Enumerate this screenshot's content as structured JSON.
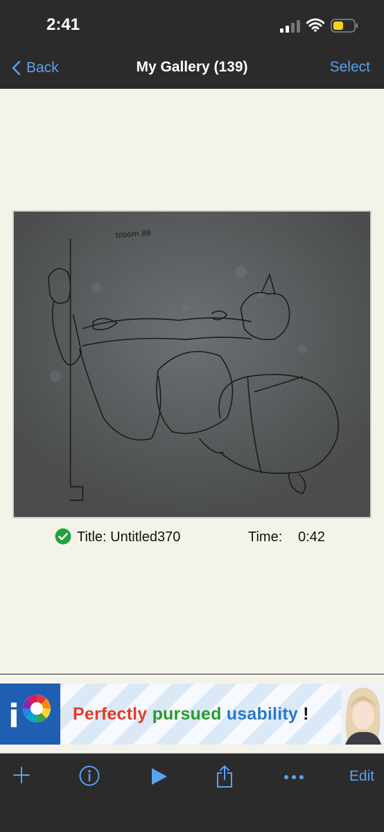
{
  "status": {
    "time": "2:41"
  },
  "nav": {
    "back_label": "Back",
    "title": "My Gallery (139)",
    "select_label": "Select"
  },
  "artwork": {
    "signature": "bloom 88"
  },
  "info": {
    "title": "Title: Untitled370",
    "time_label": "Time:",
    "time_value": "0:42"
  },
  "ad": {
    "word1": "Perfectly",
    "word2": "pursued",
    "word3": "usability",
    "word4": "!"
  },
  "toolbar": {
    "edit_label": "Edit",
    "icons": [
      "plus-icon",
      "info-icon",
      "play-icon",
      "share-icon",
      "more-icon"
    ]
  },
  "colors": {
    "accent": "#5aa2f2",
    "bar": "#2b2b2b",
    "background": "#f4f3ea",
    "check": "#1fa33a",
    "battery": "#f5d11a"
  }
}
